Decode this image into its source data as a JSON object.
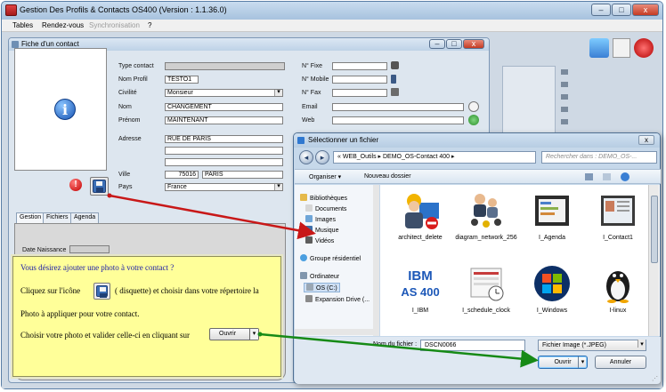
{
  "app": {
    "title": "Gestion Des Profils & Contacts OS400 (Version : 1.1.36.0)",
    "minimize": "–",
    "maximize": "□",
    "close": "x",
    "menu": {
      "tables": "Tables",
      "rendezvous": "Rendez-vous",
      "synchronisation": "Synchronisation",
      "help": "?"
    }
  },
  "fiche": {
    "title": "Fiche d'un contact",
    "labels": {
      "type_contact": "Type contact",
      "nom_profil": "Nom Profil",
      "civilite": "Civilité",
      "nom": "Nom",
      "prenom": "Prénom",
      "adresse": "Adresse",
      "ville": "Ville",
      "pays": "Pays",
      "n_fixe": "N° Fixe",
      "n_mobile": "N° Mobile",
      "n_fax": "N° Fax",
      "email": "Email",
      "web": "Web",
      "date_naissance": "Date Naissance"
    },
    "values": {
      "nom_profil": "TESTO1",
      "civilite": "Monsieur",
      "nom": "CHANGEMENT",
      "prenom": "MAINTENANT",
      "adresse": "RUE DE PARIS",
      "code_postal": "75016",
      "ville": "PARIS",
      "pays": "France"
    },
    "info_icon_glyph": "i",
    "error_icon_glyph": "!",
    "tabs": [
      "Gestion",
      "Fichiers",
      "Agenda"
    ]
  },
  "help": {
    "line1": "Vous désirez ajouter une photo à votre contact ?",
    "line2a": "Cliquez sur l'icône",
    "line2b": "(  disquette) et choisir dans votre répertoire la",
    "line3": "Photo à appliquer pour votre contact.",
    "line4": "Choisir votre photo et valider celle-ci en cliquant sur",
    "button": "Ouvrir",
    "button_arrow": "▾"
  },
  "dialog": {
    "title": "Sélectionner un fichier",
    "close": "x",
    "back": "◂",
    "forward": "▸",
    "path": "«  WEB_Outils  ▸  DEMO_OS-Contact 400  ▸",
    "search_placeholder": "Rechercher dans : DEMO_OS-...",
    "toolbar": {
      "organize": "Organiser ▾",
      "new_folder": "Nouveau dossier"
    },
    "nav": [
      "Bibliothèques",
      "Documents",
      "Images",
      "Musique",
      "Vidéos",
      "Groupe résidentiel",
      "Ordinateur",
      "OS (C:)",
      "Expansion Drive (..."
    ],
    "files": [
      {
        "name": "architect_delete"
      },
      {
        "name": "diagram_network_256"
      },
      {
        "name": "I_Agenda"
      },
      {
        "name": "I_Contact1"
      },
      {
        "name": "I_IBM"
      },
      {
        "name": "I_schedule_clock"
      },
      {
        "name": "I_Windows"
      },
      {
        "name": "I-linux"
      }
    ],
    "ibm_text": "IBM",
    "as400_text": "AS 400",
    "filename_label": "Nom du fichier :",
    "filename_value": "DSCN0066",
    "filetype": "Fichier Image (*.JPEG)",
    "open": "Ouvrir",
    "open_arrow": "▾",
    "cancel": "Annuler"
  },
  "colors": {
    "arrow_red": "#c81818",
    "arrow_green": "#168a16",
    "help_bg": "#ffff99"
  }
}
